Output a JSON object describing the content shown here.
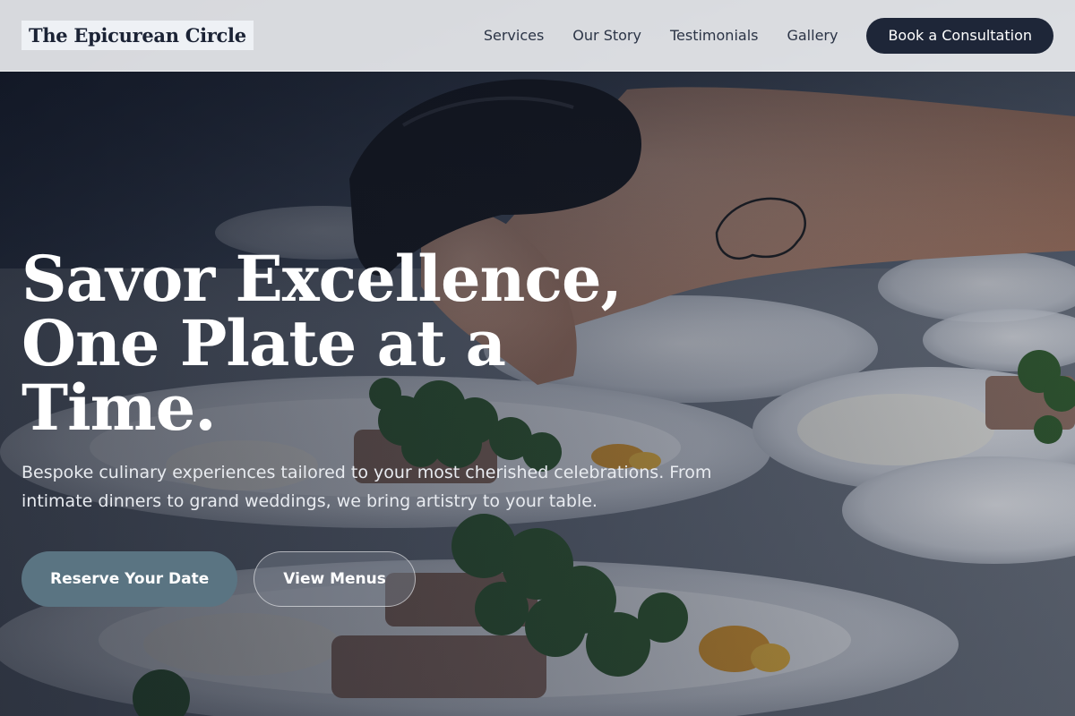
{
  "nav": {
    "brand": "The Epicurean Circle",
    "links": [
      "Services",
      "Our Story",
      "Testimonials",
      "Gallery"
    ],
    "cta": "Book a Consultation"
  },
  "hero": {
    "title": "Savor Excellence, One Plate at a Time.",
    "subtitle": "Bespoke culinary experiences tailored to your most cherished celebrations. From intimate dinners to grand weddings, we bring artistry to your table.",
    "primary_button": "Reserve Your Date",
    "secondary_button": "View Menus",
    "image_icon": "chef-plating-photo"
  },
  "colors": {
    "nav_cta_bg": "#1e2638",
    "primary_button_bg": "#5a7482",
    "text_light": "#ffffff"
  }
}
